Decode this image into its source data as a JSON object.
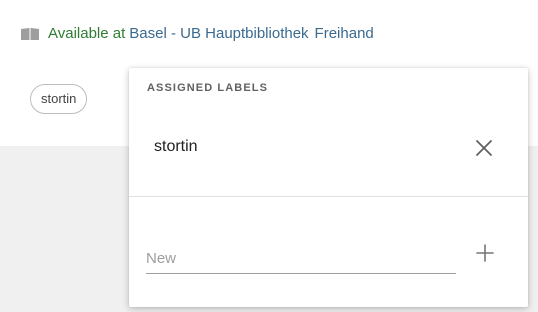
{
  "availability": {
    "status_text": "Available at",
    "location": "Basel - UB Hauptbibliothek",
    "collection": "Freihand"
  },
  "label_chip": {
    "text": "stortin"
  },
  "labels_popover": {
    "header": "ASSIGNED LABELS",
    "assigned": [
      "stortin"
    ],
    "new_label_placeholder": "New",
    "new_label_value": ""
  },
  "colors": {
    "available_green": "#2e7d32",
    "link_blue": "#3b6a8f",
    "background": "#f0f0f0"
  },
  "icons": {
    "availability": "book-icon",
    "remove": "close-icon",
    "add": "plus-icon"
  }
}
